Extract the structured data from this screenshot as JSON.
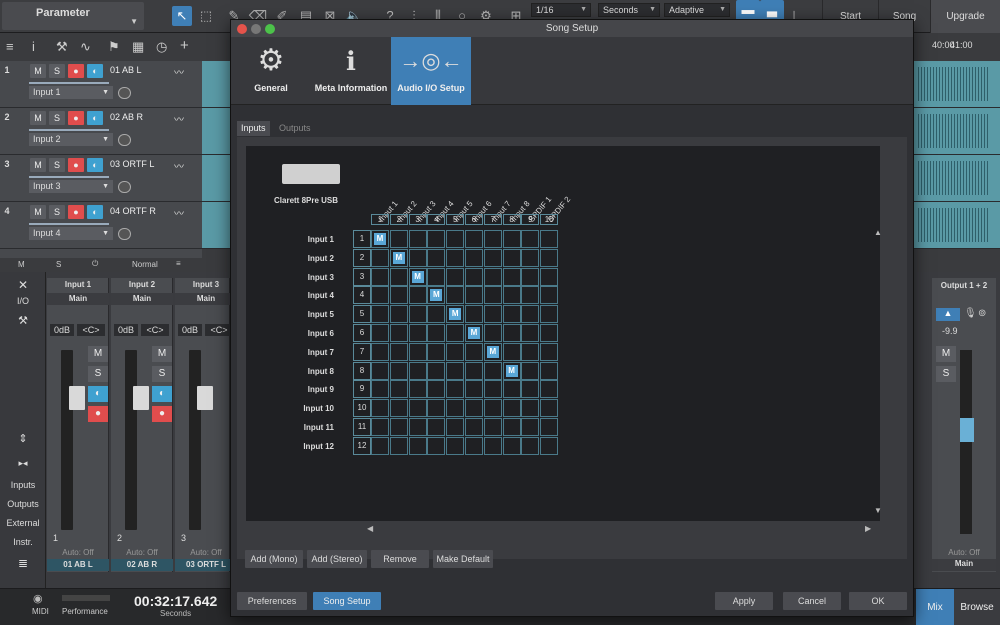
{
  "toolbar": {
    "parameter_label": "Parameter",
    "quantize": "1/16",
    "timebase": "Seconds",
    "snap": "Adaptive",
    "start": "Start",
    "song": "Song",
    "upgrade": "Upgrade"
  },
  "ruler": {
    "marks": [
      "40:00",
      "41:00"
    ]
  },
  "tracks": [
    {
      "num": "1",
      "name": "01 AB L",
      "input": "Input 1"
    },
    {
      "num": "2",
      "name": "02 AB R",
      "input": "Input 2"
    },
    {
      "num": "3",
      "name": "03 ORTF L",
      "input": "Input 3"
    },
    {
      "num": "4",
      "name": "04 ORTF R",
      "input": "Input 4"
    }
  ],
  "track_buttons": {
    "mute": "M",
    "solo": "S"
  },
  "mixbar": {
    "m": "M",
    "s": "S",
    "mode": "Normal"
  },
  "console_left": {
    "io": "I/O",
    "inputs": "Inputs",
    "outputs": "Outputs",
    "external": "External",
    "instr": "Instr."
  },
  "strips": [
    {
      "input": "Input 1",
      "bus": "Main",
      "db": "0dB",
      "pan": "<C>",
      "auto": "Auto: Off",
      "label": "01 AB L",
      "ch": "1"
    },
    {
      "input": "Input 2",
      "bus": "Main",
      "db": "0dB",
      "pan": "<C>",
      "auto": "Auto: Off",
      "label": "02 AB R",
      "ch": "2"
    },
    {
      "input": "Input 3",
      "bus": "Main",
      "db": "0dB",
      "pan": "<C>",
      "auto": "Auto: Off",
      "label": "03 ORTF L",
      "ch": "3"
    }
  ],
  "output_strip": {
    "name": "Output 1 + 2",
    "db": "-9.9",
    "auto": "Auto: Off",
    "label": "Main"
  },
  "bottom": {
    "midi": "MIDI",
    "performance": "Performance",
    "time": "00:32:17.642",
    "time_unit": "Seconds",
    "mix": "Mix",
    "browse": "Browse"
  },
  "dialog": {
    "title": "Song Setup",
    "tabs": [
      {
        "label": "General",
        "icon": "gear-icon"
      },
      {
        "label": "Meta Information",
        "icon": "info-icon"
      },
      {
        "label": "Audio I/O Setup",
        "icon": "audio-io-icon"
      }
    ],
    "subtabs": [
      "Inputs",
      "Outputs"
    ],
    "device": "Clarett 8Pre USB",
    "columns": [
      "Input 1",
      "Input 2",
      "Input 3",
      "Input 4",
      "Input 5",
      "Input 6",
      "Input 7",
      "Input 8",
      "SPDIF 1",
      "SPDIF 2"
    ],
    "column_numbers": [
      "1",
      "2",
      "3",
      "4",
      "5",
      "6",
      "7",
      "8",
      "9",
      "10"
    ],
    "rows": [
      "Input 1",
      "Input 2",
      "Input 3",
      "Input 4",
      "Input 5",
      "Input 6",
      "Input 7",
      "Input 8",
      "Input 9",
      "Input 10",
      "Input 11",
      "Input 12"
    ],
    "row_numbers": [
      "1",
      "2",
      "3",
      "4",
      "5",
      "6",
      "7",
      "8",
      "9",
      "10",
      "11",
      "12"
    ],
    "mono_marker": "M",
    "assignments": [
      [
        0,
        0
      ],
      [
        1,
        1
      ],
      [
        2,
        2
      ],
      [
        3,
        3
      ],
      [
        4,
        4
      ],
      [
        5,
        5
      ],
      [
        6,
        6
      ],
      [
        7,
        7
      ]
    ],
    "buttons": {
      "add_mono": "Add (Mono)",
      "add_stereo": "Add (Stereo)",
      "remove": "Remove",
      "make_default": "Make Default"
    },
    "footer": {
      "preferences": "Preferences",
      "song_setup": "Song Setup",
      "apply": "Apply",
      "cancel": "Cancel",
      "ok": "OK"
    }
  },
  "colors": {
    "accent": "#3f7fb6",
    "record": "#e04d4d",
    "monitor": "#3fa1d0",
    "marker": "#5aa7d6"
  }
}
